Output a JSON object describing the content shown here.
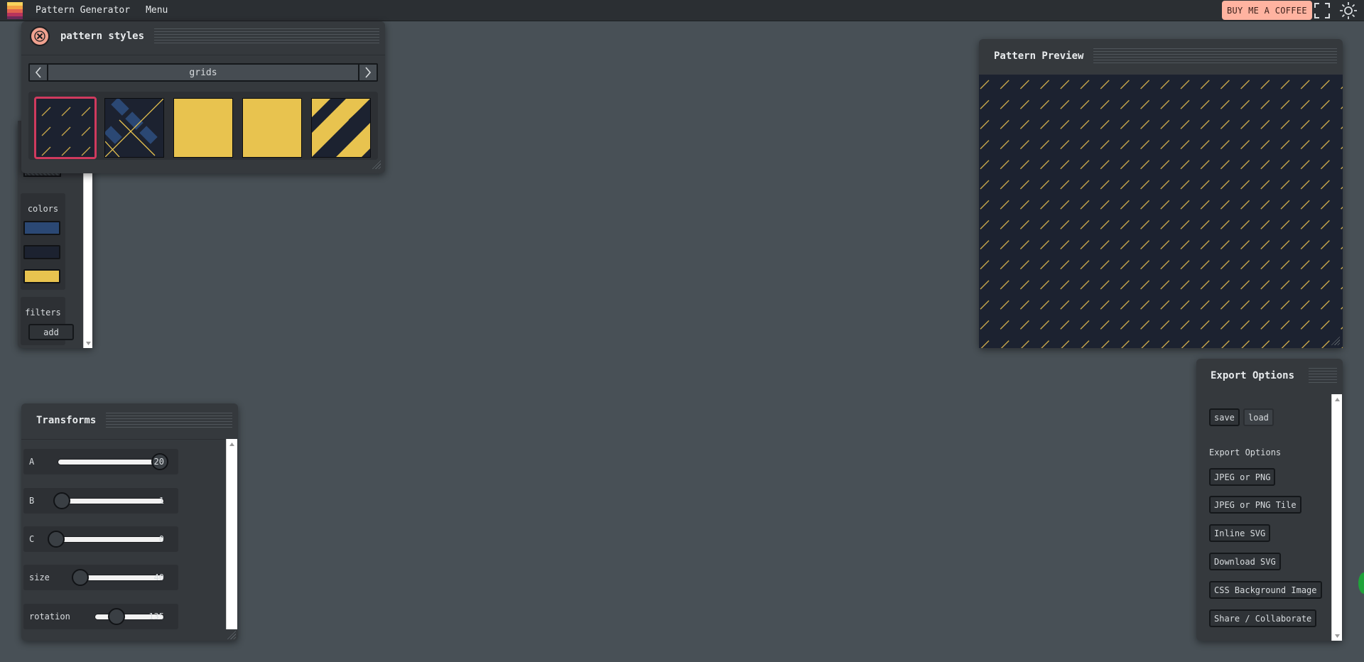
{
  "app": {
    "title": "Pattern Generator",
    "menu_label": "Menu",
    "coffee_label": "BUY ME A COFFEE",
    "fullscreen_icon": "fullscreen-icon",
    "theme_icon": "sun-icon"
  },
  "pattern_styles": {
    "title": "pattern styles",
    "close_icon": "close-icon",
    "category": "grids",
    "prev_icon": "chevron-left-icon",
    "next_icon": "chevron-right-icon",
    "selected_index": 0
  },
  "sidebar": {
    "colors_label": "colors",
    "colors": [
      "#2b4874",
      "#1c2230",
      "#e8c34f"
    ],
    "filters_label": "filters",
    "add_label": "add"
  },
  "preview": {
    "title": "Pattern Preview",
    "bg_color": "#1c2230",
    "stroke_color": "#c9a84a"
  },
  "transforms": {
    "title": "Transforms",
    "rows": [
      {
        "label": "A",
        "value": "20",
        "fraction": 1.0
      },
      {
        "label": "B",
        "value": "1",
        "fraction": 0.0
      },
      {
        "label": "C",
        "value": "0",
        "fraction": 0.0
      },
      {
        "label": "size",
        "value": "40",
        "fraction": 0.0
      },
      {
        "label": "rotation",
        "value": "135",
        "fraction": 0.5
      }
    ]
  },
  "export": {
    "title": "Export Options",
    "save_label": "save",
    "load_label": "load",
    "section_label": "Export Options",
    "options": [
      "JPEG or PNG",
      "JPEG or PNG Tile",
      "Inline SVG",
      "Download SVG",
      "CSS Background Image",
      "Share / Collaborate"
    ]
  }
}
